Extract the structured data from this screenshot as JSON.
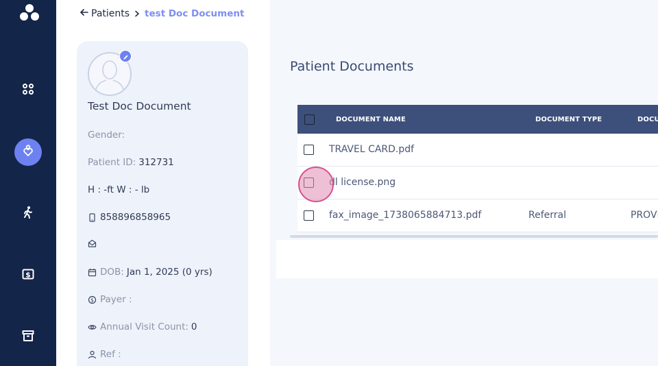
{
  "nav": {
    "items": [
      {
        "name": "dashboard",
        "icon": "grid-icon"
      },
      {
        "name": "patients",
        "icon": "heart-person-icon",
        "active": true
      },
      {
        "name": "activity",
        "icon": "walking-icon"
      },
      {
        "name": "billing",
        "icon": "dollar-icon"
      },
      {
        "name": "archive",
        "icon": "archive-icon"
      }
    ]
  },
  "breadcrumb": {
    "back_label": "Patients",
    "current": "test Doc Document"
  },
  "patient": {
    "name": "Test Doc Document",
    "gender_label": "Gender:",
    "gender_value": "",
    "patient_id_label": "Patient ID:",
    "patient_id_value": "312731",
    "height_weight": "H : -ft W : - lb",
    "phone": "858896858965",
    "email": "",
    "dob_label": "DOB:",
    "dob_value": "Jan 1, 2025 (0 yrs)",
    "payer_label": "Payer :",
    "payer_value": "",
    "visit_count_label": "Annual Visit Count:",
    "visit_count_value": "0",
    "ref_label": "Ref :",
    "ref_value": ""
  },
  "documents": {
    "title": "Patient Documents",
    "columns": [
      "DOCUMENT NAME",
      "DOCUMENT TYPE",
      "DOCU"
    ],
    "rows": [
      {
        "name": "TRAVEL CARD.pdf",
        "type": "",
        "third": ""
      },
      {
        "name": "dl license.png",
        "type": "",
        "third": ""
      },
      {
        "name": "fax_image_1738065884713.pdf",
        "type": "Referral",
        "third": "PROVI"
      }
    ]
  },
  "colors": {
    "rail": "#14254a",
    "accent": "#6d82f0",
    "table_header": "#3d4f7b",
    "click_ring": "#d94f8e"
  }
}
